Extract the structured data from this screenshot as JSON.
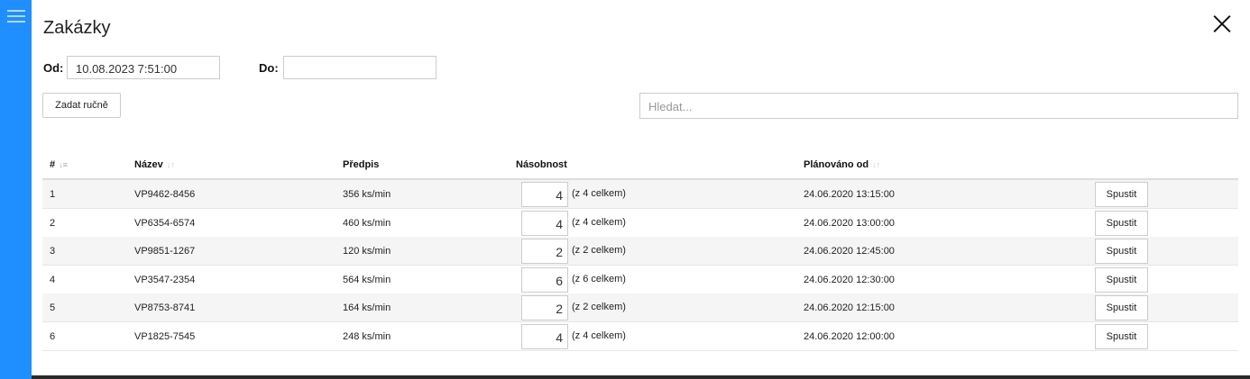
{
  "app": {
    "title": "Zakázky"
  },
  "filters": {
    "od_label": "Od:",
    "od_value": "10.08.2023 7:51:00",
    "do_label": "Do:",
    "do_value": ""
  },
  "toolbar": {
    "manual_label": "Zadat ručně"
  },
  "search": {
    "placeholder": "Hledat..."
  },
  "table": {
    "headers": {
      "id": "#",
      "name": "Název",
      "spec": "Předpis",
      "multiplicity": "Násobnost",
      "planned": "Plánováno od"
    },
    "rows": [
      {
        "id": "1",
        "name": "VP9462-8456",
        "spec": "356 ks/min",
        "qty": "4",
        "total": "(z 4 celkem)",
        "planned": "24.06.2020 13:15:00",
        "action": "Spustit"
      },
      {
        "id": "2",
        "name": "VP6354-6574",
        "spec": "460 ks/min",
        "qty": "4",
        "total": "(z 4 celkem)",
        "planned": "24.06.2020 13:00:00",
        "action": "Spustit"
      },
      {
        "id": "3",
        "name": "VP9851-1267",
        "spec": "120 ks/min",
        "qty": "2",
        "total": "(z 2 celkem)",
        "planned": "24.06.2020 12:45:00",
        "action": "Spustit"
      },
      {
        "id": "4",
        "name": "VP3547-2354",
        "spec": "564 ks/min",
        "qty": "6",
        "total": "(z 6 celkem)",
        "planned": "24.06.2020 12:30:00",
        "action": "Spustit"
      },
      {
        "id": "5",
        "name": "VP8753-8741",
        "spec": "164 ks/min",
        "qty": "2",
        "total": "(z 2 celkem)",
        "planned": "24.06.2020 12:15:00",
        "action": "Spustit"
      },
      {
        "id": "6",
        "name": "VP1825-7545",
        "spec": "248 ks/min",
        "qty": "4",
        "total": "(z 4 celkem)",
        "planned": "24.06.2020 12:00:00",
        "action": "Spustit"
      }
    ]
  },
  "colors": {
    "sidebar": "#1f8fff",
    "stripe": "#f5f5f5"
  }
}
